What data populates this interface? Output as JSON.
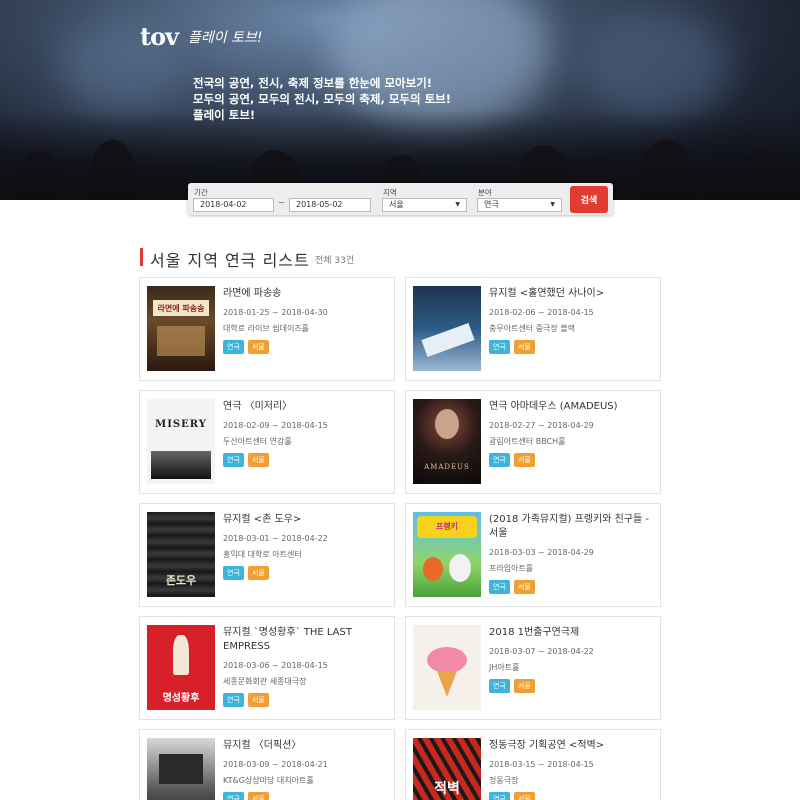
{
  "header": {
    "logo_mark": "tov",
    "logo_text": "플레이 토브!",
    "copy_line1": "전국의 공연, 전시, 축제 정보를 한눈에 모아보기!",
    "copy_line2": "모두의 공연, 모두의 전시, 모두의 축제, 모두의 토브!",
    "copy_line3": "플레이 토브!"
  },
  "search": {
    "period_label": "기간",
    "start_date": "2018-04-02",
    "tilde": "~",
    "end_date": "2018-05-02",
    "region_label": "지역",
    "region_value": "서울",
    "category_label": "분야",
    "category_value": "연극",
    "button_label": "검색"
  },
  "section": {
    "title": "서울 지역 연극 리스트",
    "count": "전체 33건"
  },
  "items": [
    {
      "title": "라면에 파송송",
      "date": "2018-01-25 ~ 2018-04-30",
      "venue": "대학로 라이브 씸데이즈홀",
      "genre": "연극",
      "region": "서울"
    },
    {
      "title": "뮤지컬 <홀연했던 사나이>",
      "date": "2018-02-06 ~ 2018-04-15",
      "venue": "충무아트센터 중극장 블랙",
      "genre": "연극",
      "region": "서울"
    },
    {
      "title": "연극 〈미저리〉",
      "date": "2018-02-09 ~ 2018-04-15",
      "venue": "두산아트센터 연강홀",
      "genre": "연극",
      "region": "서울"
    },
    {
      "title": "연극 아마데우스 (AMADEUS)",
      "date": "2018-02-27 ~ 2018-04-29",
      "venue": "광림아트센터 BBCH홀",
      "genre": "연극",
      "region": "서울"
    },
    {
      "title": "뮤지컬 <존 도우>",
      "date": "2018-03-01 ~ 2018-04-22",
      "venue": "홍익대 대학로 아트센터",
      "genre": "연극",
      "region": "서울"
    },
    {
      "title": "(2018 가족뮤지컬) 프렝키와 친구들 - 서울",
      "date": "2018-03-03 ~ 2018-04-29",
      "venue": "프라임아트홀",
      "genre": "연극",
      "region": "서울"
    },
    {
      "title": "뮤지컬 `명성황후` THE LAST EMPRESS",
      "date": "2018-03-06 ~ 2018-04-15",
      "venue": "세종문화회관 세종대극장",
      "genre": "연극",
      "region": "서울"
    },
    {
      "title": "2018 1번출구연극제",
      "date": "2018-03-07 ~ 2018-04-22",
      "venue": "JH아트홀",
      "genre": "연극",
      "region": "서울"
    },
    {
      "title": "뮤지컬 〈더픽션〉",
      "date": "2018-03-09 ~ 2018-04-21",
      "venue": "KT&G상상마당 대치아트홀",
      "genre": "연극",
      "region": "서울"
    },
    {
      "title": "정동극장 기획공연 <적벽>",
      "date": "2018-03-15 ~ 2018-04-15",
      "venue": "정동극장",
      "genre": "연극",
      "region": "서울"
    }
  ],
  "posters": [
    {
      "text": "라면에 파송송"
    },
    {
      "text": ""
    },
    {
      "text": "MISERY"
    },
    {
      "text": "AMADEUS"
    },
    {
      "text": "존도우"
    },
    {
      "text": "프렝키"
    },
    {
      "text": "명성황후"
    },
    {
      "text": ""
    },
    {
      "text": ""
    },
    {
      "text": "적벽"
    }
  ]
}
